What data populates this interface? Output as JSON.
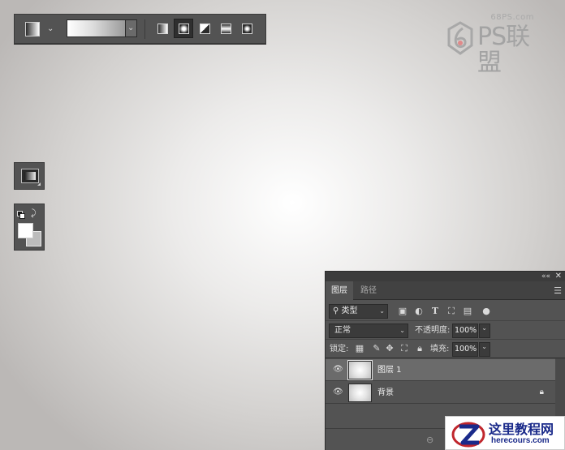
{
  "options_bar": {
    "gradient_types": [
      {
        "name": "linear"
      },
      {
        "name": "radial",
        "active": true
      },
      {
        "name": "angle"
      },
      {
        "name": "reflected"
      },
      {
        "name": "diamond"
      }
    ]
  },
  "logo": {
    "site": "68PS.com",
    "brand": "PS联盟"
  },
  "colors": {
    "foreground": "#ffffff",
    "background": "#bcbcbc",
    "canvas_center": "#ffffff",
    "canvas_edge": "#bbb8b6",
    "panel_bg": "#535353",
    "selected_layer_bg": "#6b6b6b"
  },
  "layers_panel": {
    "tabs": [
      {
        "label": "图层",
        "active": true
      },
      {
        "label": "路径",
        "active": false
      }
    ],
    "filter": {
      "value": "类型"
    },
    "blend_mode": "正常",
    "opacity": {
      "label": "不透明度:",
      "value": "100%"
    },
    "lock": {
      "label": "锁定:"
    },
    "fill": {
      "label": "填充:",
      "value": "100%"
    },
    "layers": [
      {
        "name": "图层 1",
        "selected": true,
        "locked": false
      },
      {
        "name": "背景",
        "selected": false,
        "locked": true
      }
    ]
  },
  "watermark": {
    "cn": "这里教程网",
    "en": "herecours.com"
  }
}
